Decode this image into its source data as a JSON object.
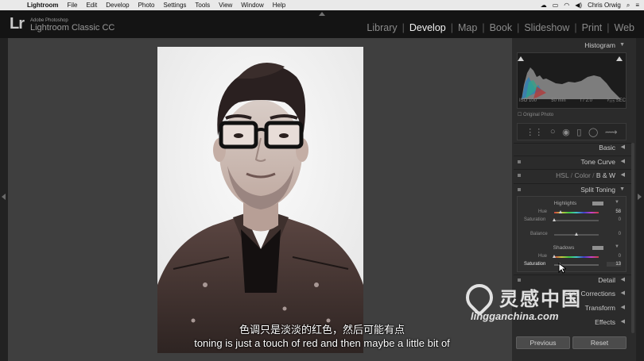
{
  "menubar": {
    "app_name": "Lightroom",
    "items": [
      "File",
      "Edit",
      "Develop",
      "Photo",
      "Settings",
      "Tools",
      "View",
      "Window",
      "Help"
    ],
    "user": "Chris Orwig"
  },
  "app": {
    "logo": "Lr",
    "vendor": "Adobe Photoshop",
    "name": "Lightroom Classic CC"
  },
  "modules": [
    {
      "label": "Library",
      "active": false
    },
    {
      "label": "Develop",
      "active": true
    },
    {
      "label": "Map",
      "active": false
    },
    {
      "label": "Book",
      "active": false
    },
    {
      "label": "Slideshow",
      "active": false
    },
    {
      "label": "Print",
      "active": false
    },
    {
      "label": "Web",
      "active": false
    }
  ],
  "panel": {
    "histogram_title": "Histogram",
    "hist_info": {
      "iso": "ISO 100",
      "focal": "50 mm",
      "aperture": "f / 2.0",
      "shutter": "¹⁄₁₂₅ SEC"
    },
    "original_photo": "Original Photo",
    "basic": "Basic",
    "tone_curve": "Tone Curve",
    "hsl": {
      "hsl": "HSL",
      "color": "Color",
      "bw": "B & W"
    },
    "split_toning": "Split Toning",
    "highlights": {
      "title": "Highlights",
      "hue_label": "Hue",
      "hue_value": "58",
      "sat_label": "Saturation",
      "sat_value": "0"
    },
    "balance": {
      "label": "Balance",
      "value": "0"
    },
    "shadows": {
      "title": "Shadows",
      "hue_label": "Hue",
      "hue_value": "0",
      "sat_label": "Saturation",
      "sat_value": "13"
    },
    "detail": "Detail",
    "lens_corrections": "Lens Corrections",
    "transform": "Transform",
    "effects": "Effects",
    "previous": "Previous",
    "reset": "Reset"
  },
  "subtitles": {
    "cn": "色调只是淡淡的红色，然后可能有点",
    "en": "toning is just a touch of red and then maybe a little bit of"
  },
  "watermark": {
    "cn": "灵感中国",
    "en": "lingganchina.com"
  },
  "sliders": {
    "highlights_hue": 0.16,
    "highlights_sat": 0.0,
    "balance": 0.5,
    "shadows_hue": 0.0,
    "shadows_sat": 0.13
  },
  "colors": {
    "accent": "#f2f2f2",
    "panel": "#2b2b2b",
    "canvas": "#3f3f3f"
  }
}
